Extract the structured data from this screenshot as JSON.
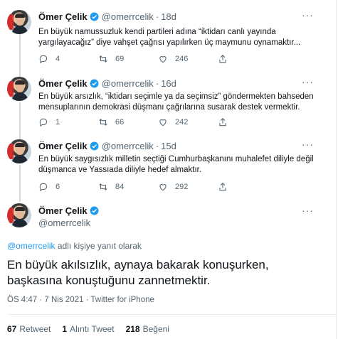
{
  "author": {
    "name": "Ömer Çelik",
    "handle": "@omerrcelik"
  },
  "thread": [
    {
      "time": "18d",
      "text_line1": "En büyük namussuzluk kendi partileri adına “iktidarı canlı yayında",
      "text_line2": "yargılayacağız” diye vahşet çağrısı yapılırken üç maymunu oynamaktır...",
      "replies": "4",
      "retweets": "69",
      "likes": "246"
    },
    {
      "time": "16d",
      "text_line1": "En büyük arsızlık, “iktidarı seçimle ya da seçimsiz” göndermekten bahseden",
      "text_line2": "mensuplarının demokrasi düşmanı çağrılarına susarak destek vermektir.",
      "replies": "1",
      "retweets": "66",
      "likes": "242"
    },
    {
      "time": "15d",
      "text_line1": "En büyük saygısızlık milletin seçtiği Cumhurbaşkanını muhalefet diliyle değil",
      "text_line2": "düşmanca ve Yassıada diliyle hedef almaktır.",
      "replies": "6",
      "retweets": "84",
      "likes": "292"
    }
  ],
  "main_tweet": {
    "reply_to_handle": "@omerrcelik",
    "reply_to_suffix": " adlı kişiye yanıt olarak",
    "text_line1": "En büyük akılsızlık, aynaya bakarak konuşurken,",
    "text_line2": "başkasına konuştuğunu zannetmektir.",
    "meta": "ÖS 4:47 · 7 Nis 2021 · Twitter for iPhone",
    "retweet_count": "67",
    "retweet_label": "Retweet",
    "quote_count": "1",
    "quote_label": "Alıntı Tweet",
    "like_count": "218",
    "like_label": "Beğeni"
  },
  "colors": {
    "accent": "#1d9bf0",
    "secondary_text": "#536471",
    "primary_text": "#0f1419",
    "thread_line": "#cfd9de"
  },
  "icons": [
    "verified-badge-icon",
    "reply-icon",
    "retweet-icon",
    "like-icon",
    "share-icon",
    "more-icon"
  ]
}
